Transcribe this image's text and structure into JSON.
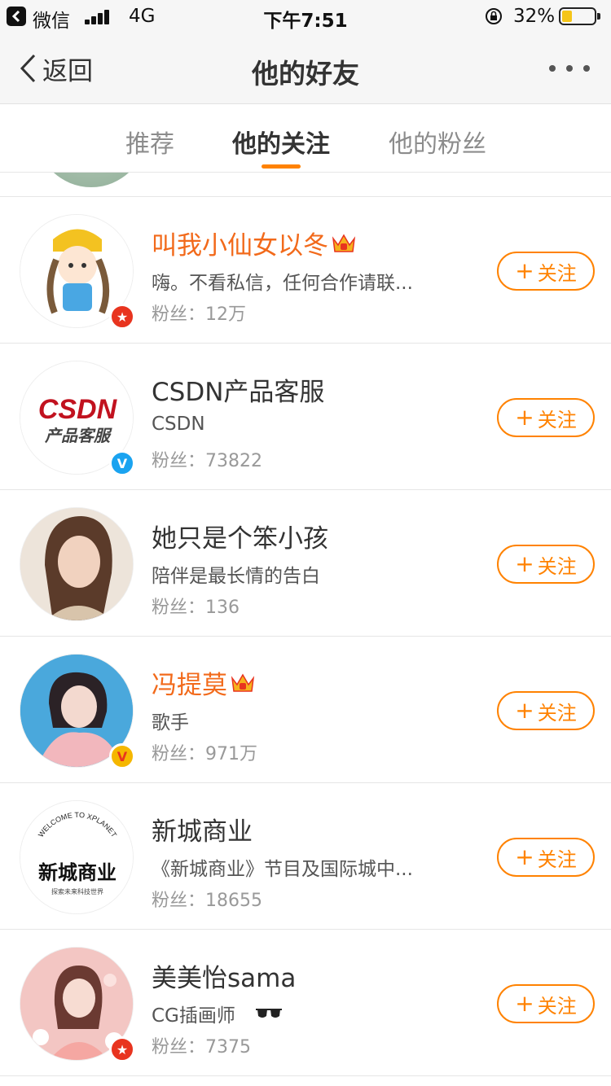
{
  "status_bar": {
    "back_app_label": "微信",
    "network": "4G",
    "time": "下午7:51",
    "battery_percent": "32%",
    "battery_level": 0.32
  },
  "nav": {
    "back_label": "返回",
    "title": "他的好友"
  },
  "tabs": [
    {
      "label": "推荐",
      "active": false
    },
    {
      "label": "他的关注",
      "active": true
    },
    {
      "label": "他的粉丝",
      "active": false
    }
  ],
  "follow_label": "关注",
  "users": [
    {
      "name": "叫我小仙女以冬",
      "vip": true,
      "desc": "嗨。不看私信，任何合作请联...",
      "fans_label": "粉丝：",
      "fans": "12万",
      "badge": "red-star"
    },
    {
      "name": "CSDN产品客服",
      "vip": false,
      "desc": "CSDN",
      "fans_label": "粉丝：",
      "fans": "73822",
      "badge": "blue-v"
    },
    {
      "name": "她只是个笨小孩",
      "vip": false,
      "desc": "陪伴是最长情的告白",
      "fans_label": "粉丝：",
      "fans": "136",
      "badge": ""
    },
    {
      "name": "冯提莫",
      "vip": true,
      "desc": "歌手",
      "fans_label": "粉丝：",
      "fans": "971万",
      "badge": "gold-v"
    },
    {
      "name": "新城商业",
      "vip": false,
      "desc": "《新城商业》节目及国际城中...",
      "fans_label": "粉丝：",
      "fans": "18655",
      "badge": ""
    },
    {
      "name": "美美怡sama",
      "vip": false,
      "desc": "CG插画师",
      "fans_label": "粉丝：",
      "fans": "7375",
      "badge": "red-star"
    }
  ],
  "avatar_text": {
    "csdn_logo": "CSDN",
    "csdn_sub": "产品客服",
    "xinc_top": "WELCOME TO XPLANET",
    "xinc_main": "新城商业",
    "xinc_sub": "探索未来科技世界"
  },
  "colors": {
    "accent": "#ff8200",
    "vip_name": "#f26a1b"
  }
}
